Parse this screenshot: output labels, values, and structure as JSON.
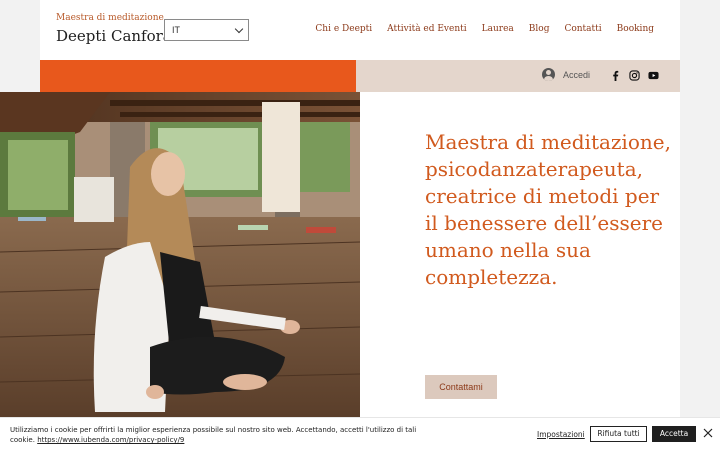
{
  "brand": {
    "subtitle": "Maestra di meditazione",
    "title": "Deepti Canfora"
  },
  "language": {
    "selected": "IT"
  },
  "nav": {
    "items": [
      {
        "label": "Chi e Deepti"
      },
      {
        "label": "Attività ed Eventi"
      },
      {
        "label": "Laurea"
      },
      {
        "label": "Blog"
      },
      {
        "label": "Contatti"
      },
      {
        "label": "Booking"
      }
    ]
  },
  "login": {
    "label": "Accedi"
  },
  "socials": [
    "facebook-icon",
    "instagram-icon",
    "youtube-icon"
  ],
  "hero": {
    "text": "Maestra di meditazione, psicodanzaterapeuta, creatrice di metodi per il benessere dell’essere umano nella sua completezza.",
    "cta_label": "Contattami"
  },
  "cookie": {
    "text": "Utilizziamo i cookie per offrirti la miglior esperienza possibile sul nostro sito web. Accettando, accetti l'utilizzo di tali cookie.",
    "link": "https://www.iubenda.com/privacy-policy/9",
    "preferences_label": "Impostazioni",
    "reject_label": "Rifiuta tutti",
    "accept_label": "Accetta"
  },
  "colors": {
    "accent": "#e8581c",
    "beige": "#e4d6cc",
    "text_accent": "#d15a1e",
    "nav": "#8c3a1a"
  }
}
